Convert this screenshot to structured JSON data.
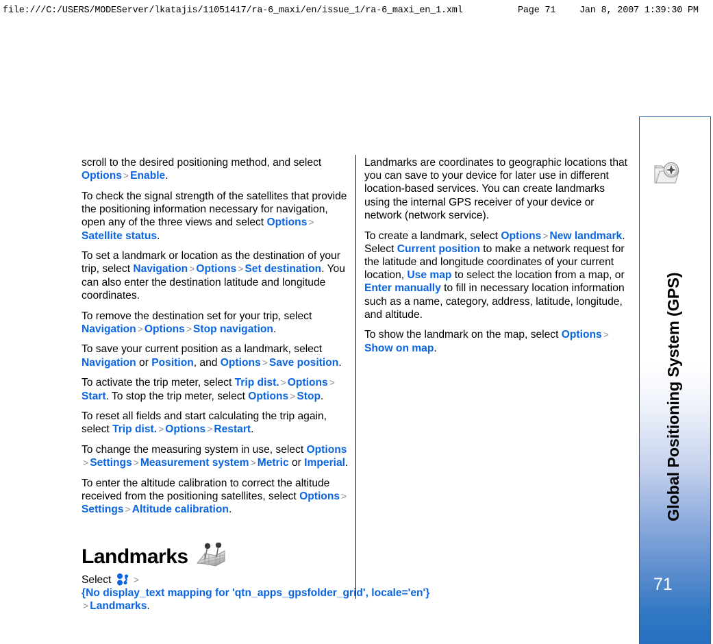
{
  "print_header": {
    "url": "file:///C:/USERS/MODEServer/lkatajis/11051417/ra-6_maxi/en/issue_1/ra-6_maxi_en_1.xml",
    "page": "Page 71",
    "date": "Jan 8, 2007 1:39:30 PM"
  },
  "side_tab": {
    "chapter_title": "Global Positioning System (GPS)",
    "page_number": "71",
    "icon": "gps-folder-compass-icon",
    "accent_color": "#2670bf",
    "border_color": "#1f5fa8"
  },
  "colors": {
    "link": "#0b64e0",
    "arrow": "#8d8d8d",
    "body_text": "#000000"
  },
  "left_column": {
    "paragraphs": [
      {
        "runs": [
          {
            "t": "text",
            "v": "scroll to the desired positioning method, and select "
          },
          {
            "t": "link",
            "v": "Options"
          },
          {
            "t": "arrow",
            "v": ">"
          },
          {
            "t": "link",
            "v": "Enable"
          },
          {
            "t": "text",
            "v": "."
          }
        ]
      },
      {
        "runs": [
          {
            "t": "text",
            "v": "To check the signal strength of the satellites that provide the positioning information necessary for navigation, open any of the three views and select "
          },
          {
            "t": "link",
            "v": "Options"
          },
          {
            "t": "arrow",
            "v": ">"
          },
          {
            "t": "link",
            "v": "Satellite status"
          },
          {
            "t": "text",
            "v": "."
          }
        ]
      },
      {
        "runs": [
          {
            "t": "text",
            "v": "To set a landmark or location as the destination of your trip, select "
          },
          {
            "t": "link",
            "v": "Navigation"
          },
          {
            "t": "arrow",
            "v": ">"
          },
          {
            "t": "link",
            "v": "Options"
          },
          {
            "t": "arrow",
            "v": ">"
          },
          {
            "t": "link",
            "v": "Set destination"
          },
          {
            "t": "text",
            "v": ". You can also enter the destination latitude and longitude coordinates."
          }
        ]
      },
      {
        "runs": [
          {
            "t": "text",
            "v": "To remove the destination set for your trip, select "
          },
          {
            "t": "link",
            "v": "Navigation"
          },
          {
            "t": "arrow",
            "v": ">"
          },
          {
            "t": "link",
            "v": "Options"
          },
          {
            "t": "arrow",
            "v": ">"
          },
          {
            "t": "link",
            "v": "Stop navigation"
          },
          {
            "t": "text",
            "v": "."
          }
        ]
      },
      {
        "runs": [
          {
            "t": "text",
            "v": "To save your current position as a landmark, select "
          },
          {
            "t": "link",
            "v": "Navigation"
          },
          {
            "t": "text",
            "v": " or "
          },
          {
            "t": "link",
            "v": "Position"
          },
          {
            "t": "text",
            "v": ", and "
          },
          {
            "t": "link",
            "v": "Options"
          },
          {
            "t": "arrow",
            "v": ">"
          },
          {
            "t": "link",
            "v": "Save position"
          },
          {
            "t": "text",
            "v": "."
          }
        ]
      },
      {
        "runs": [
          {
            "t": "text",
            "v": "To activate the trip meter, select "
          },
          {
            "t": "link",
            "v": "Trip dist."
          },
          {
            "t": "arrow",
            "v": ">"
          },
          {
            "t": "link",
            "v": "Options"
          },
          {
            "t": "arrow",
            "v": ">"
          },
          {
            "t": "link",
            "v": "Start"
          },
          {
            "t": "text",
            "v": ". To stop the trip meter, select "
          },
          {
            "t": "link",
            "v": "Options"
          },
          {
            "t": "arrow",
            "v": ">"
          },
          {
            "t": "link",
            "v": "Stop"
          },
          {
            "t": "text",
            "v": "."
          }
        ]
      },
      {
        "runs": [
          {
            "t": "text",
            "v": "To reset all fields and start calculating the trip again, select "
          },
          {
            "t": "link",
            "v": "Trip dist."
          },
          {
            "t": "arrow",
            "v": ">"
          },
          {
            "t": "link",
            "v": "Options"
          },
          {
            "t": "arrow",
            "v": ">"
          },
          {
            "t": "link",
            "v": "Restart"
          },
          {
            "t": "text",
            "v": "."
          }
        ]
      },
      {
        "runs": [
          {
            "t": "text",
            "v": "To change the measuring system in use, select "
          },
          {
            "t": "link",
            "v": "Options"
          },
          {
            "t": "arrow",
            "v": ">"
          },
          {
            "t": "link",
            "v": "Settings"
          },
          {
            "t": "arrow",
            "v": ">"
          },
          {
            "t": "link",
            "v": "Measurement system"
          },
          {
            "t": "arrow",
            "v": ">"
          },
          {
            "t": "link",
            "v": "Metric"
          },
          {
            "t": "text",
            "v": " or "
          },
          {
            "t": "link",
            "v": "Imperial"
          },
          {
            "t": "text",
            "v": "."
          }
        ]
      },
      {
        "runs": [
          {
            "t": "text",
            "v": "To enter the altitude calibration to correct the altitude received from the positioning satellites, select "
          },
          {
            "t": "link",
            "v": "Options"
          },
          {
            "t": "arrow",
            "v": ">"
          },
          {
            "t": "link",
            "v": "Settings"
          },
          {
            "t": "arrow",
            "v": ">"
          },
          {
            "t": "link",
            "v": "Altitude calibration"
          },
          {
            "t": "text",
            "v": "."
          }
        ]
      }
    ],
    "section_heading": {
      "text": "Landmarks",
      "icon": "folded-map-with-pins-icon"
    },
    "section_paragraphs": [
      {
        "runs": [
          {
            "t": "text",
            "v": "Select "
          },
          {
            "t": "icon",
            "v": "gps-folder-grid-icon"
          },
          {
            "t": "arrow",
            "v": ">"
          },
          {
            "t": "link",
            "v": "{No display_text mapping for 'qtn_apps_gpsfolder_grid', locale='en'}"
          },
          {
            "t": "arrow",
            "v": ">"
          },
          {
            "t": "link",
            "v": "Landmarks"
          },
          {
            "t": "text",
            "v": "."
          }
        ]
      }
    ]
  },
  "right_column": {
    "paragraphs": [
      {
        "runs": [
          {
            "t": "text",
            "v": "Landmarks are coordinates to geographic locations that you can save to your device for later use in different location-based services. You can create landmarks using the internal GPS receiver of your device or network (network service)."
          }
        ]
      },
      {
        "runs": [
          {
            "t": "text",
            "v": "To create a landmark, select "
          },
          {
            "t": "link",
            "v": "Options"
          },
          {
            "t": "arrow",
            "v": ">"
          },
          {
            "t": "link",
            "v": "New landmark"
          },
          {
            "t": "text",
            "v": ". Select "
          },
          {
            "t": "link",
            "v": "Current position"
          },
          {
            "t": "text",
            "v": " to make a network request for the latitude and longitude coordinates of your current location, "
          },
          {
            "t": "link",
            "v": "Use map"
          },
          {
            "t": "text",
            "v": " to select the location from a map, or "
          },
          {
            "t": "link",
            "v": "Enter manually"
          },
          {
            "t": "text",
            "v": " to fill in necessary location information such as a name, category, address, latitude, longitude, and altitude."
          }
        ]
      },
      {
        "runs": [
          {
            "t": "text",
            "v": "To show the landmark on the map, select "
          },
          {
            "t": "link",
            "v": "Options"
          },
          {
            "t": "arrow",
            "v": ">"
          },
          {
            "t": "link",
            "v": "Show on map"
          },
          {
            "t": "text",
            "v": "."
          }
        ]
      }
    ]
  }
}
